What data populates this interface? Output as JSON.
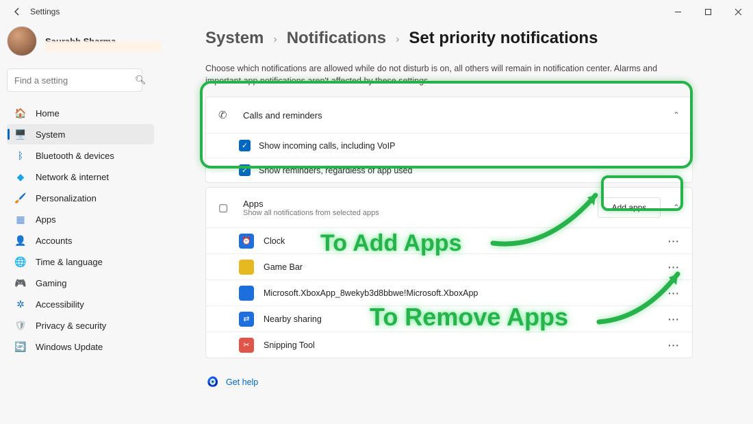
{
  "window": {
    "title": "Settings"
  },
  "user": {
    "name": "Saurabh Sharma"
  },
  "search": {
    "placeholder": "Find a setting"
  },
  "nav": [
    {
      "icon": "🏠",
      "label": "Home",
      "color": "#888"
    },
    {
      "icon": "🖥️",
      "label": "System",
      "color": "#0067c0",
      "active": true
    },
    {
      "icon": "ᛒ",
      "label": "Bluetooth & devices",
      "color": "#0067c0"
    },
    {
      "icon": "◆",
      "label": "Network & internet",
      "color": "#1aa3e8"
    },
    {
      "icon": "🖌️",
      "label": "Personalization",
      "color": "#d87a3a"
    },
    {
      "icon": "▦",
      "label": "Apps",
      "color": "#5a8dd6"
    },
    {
      "icon": "👤",
      "label": "Accounts",
      "color": "#2aa36e"
    },
    {
      "icon": "🌐",
      "label": "Time & language",
      "color": "#2a7ec9"
    },
    {
      "icon": "🎮",
      "label": "Gaming",
      "color": "#888"
    },
    {
      "icon": "✲",
      "label": "Accessibility",
      "color": "#1a6fbf"
    },
    {
      "icon": "🛡",
      "label": "Privacy & security",
      "color": "#9aa6ad"
    },
    {
      "icon": "🔄",
      "label": "Windows Update",
      "color": "#1a8cd8"
    }
  ],
  "breadcrumb": {
    "a": "System",
    "b": "Notifications",
    "c": "Set priority notifications"
  },
  "description": "Choose which notifications are allowed while do not disturb is on, all others will remain in notification center. Alarms and important app notifications aren't affected by these settings.",
  "calls": {
    "title": "Calls and reminders",
    "opt1": "Show incoming calls, including VoIP",
    "opt2": "Show reminders, regardless of app used"
  },
  "apps": {
    "title": "Apps",
    "subtitle": "Show all notifications from selected apps",
    "add_button": "Add apps",
    "list": [
      {
        "name": "Clock",
        "bg": "#1d6fe0",
        "glyph": "⏰"
      },
      {
        "name": "Game Bar",
        "bg": "#e5b91f",
        "glyph": ""
      },
      {
        "name": "Microsoft.XboxApp_8wekyb3d8bbwe!Microsoft.XboxApp",
        "bg": "#1d6fe0",
        "glyph": ""
      },
      {
        "name": "Nearby sharing",
        "bg": "#1d6fe0",
        "glyph": "⇄"
      },
      {
        "name": "Snipping Tool",
        "bg": "#e0554a",
        "glyph": "✂"
      }
    ]
  },
  "help": {
    "label": "Get help"
  },
  "annotations": {
    "add_text": "To Add Apps",
    "remove_text": "To Remove Apps"
  }
}
